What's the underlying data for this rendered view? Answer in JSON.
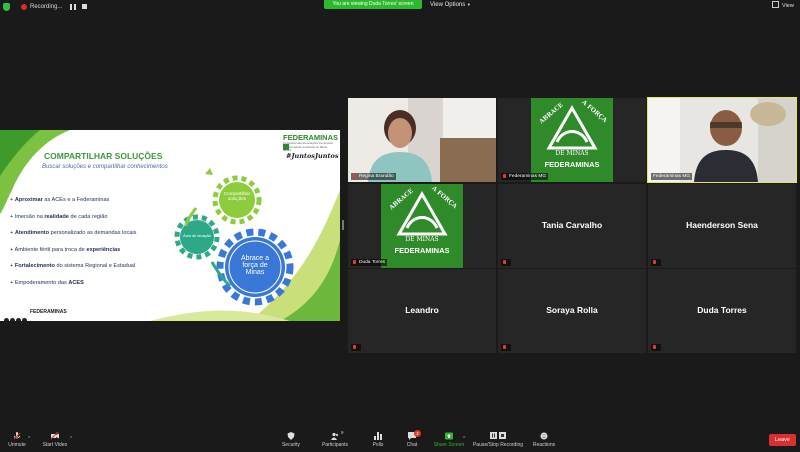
{
  "topbar": {
    "recording_label": "Recording...",
    "viewing_banner": "You are viewing Duda Torres' screen",
    "view_options": "View Options",
    "view_label": "View"
  },
  "slide": {
    "title": "COMPARTILHAR SOLUÇÕES",
    "subtitle": "Buscar soluções e compartilhar conhecimentos",
    "brand": "FEDERAMINAS",
    "brand_sub": "Federação das Associações Comerciais e Empresariais do Estado de Minas Gerais",
    "hashtag": "#JuntosJuntos",
    "bullets": [
      {
        "pre": "+ ",
        "bold": "Aproximar",
        "post": " as ACEs e a Federaminas"
      },
      {
        "pre": "+ Imersão na ",
        "bold": "realidade",
        "post": " de cada região"
      },
      {
        "pre": "+ ",
        "bold": "Atendimento",
        "post": " personalizado as demandas locais"
      },
      {
        "pre": "+ Ambiente fértil para troca de ",
        "bold": "experiências",
        "post": ""
      },
      {
        "pre": "+ ",
        "bold": "Fortalecimento",
        "post": " do sistema Regional e Estadual"
      },
      {
        "pre": "+ Empoderamento das ",
        "bold": "ACES",
        "post": ""
      }
    ],
    "gear_top": "Compartilhar soluções",
    "gear_left": "Área de atuação",
    "gear_big": "Abrace a força de Minas",
    "footer_brand": "FEDERAMINAS"
  },
  "tiles": [
    {
      "name": "",
      "label": "Regina Brandão"
    },
    {
      "name": "",
      "label": "Federaminas MG"
    },
    {
      "name": "",
      "label": "Federaminas MG"
    },
    {
      "name": "",
      "label": "Duda Torres"
    },
    {
      "name": "Tania Carvalho",
      "label": ""
    },
    {
      "name": "Haenderson Sena",
      "label": ""
    },
    {
      "name": "Leandro",
      "label": ""
    },
    {
      "name": "Soraya Rolla",
      "label": ""
    },
    {
      "name": "Duda Torres",
      "label": ""
    }
  ],
  "logo": {
    "left_text": "ABRACE",
    "right_text": "A FORÇA",
    "minas": "DE MINAS",
    "brand": "FEDERAMINAS"
  },
  "toolbar": {
    "unmute": "Unmute",
    "start_video": "Start Video",
    "security": "Security",
    "participants": "Participants",
    "participants_count": "9",
    "polls": "Polls",
    "chat": "Chat",
    "chat_badge": "2",
    "share_screen": "Share Screen",
    "record": "Pause/Stop Recording",
    "reactions": "Reactions",
    "leave": "Leave"
  },
  "colors": {
    "accent_green": "#2eb82e",
    "leave_red": "#d83030",
    "active_speaker": "#e8e94a"
  }
}
